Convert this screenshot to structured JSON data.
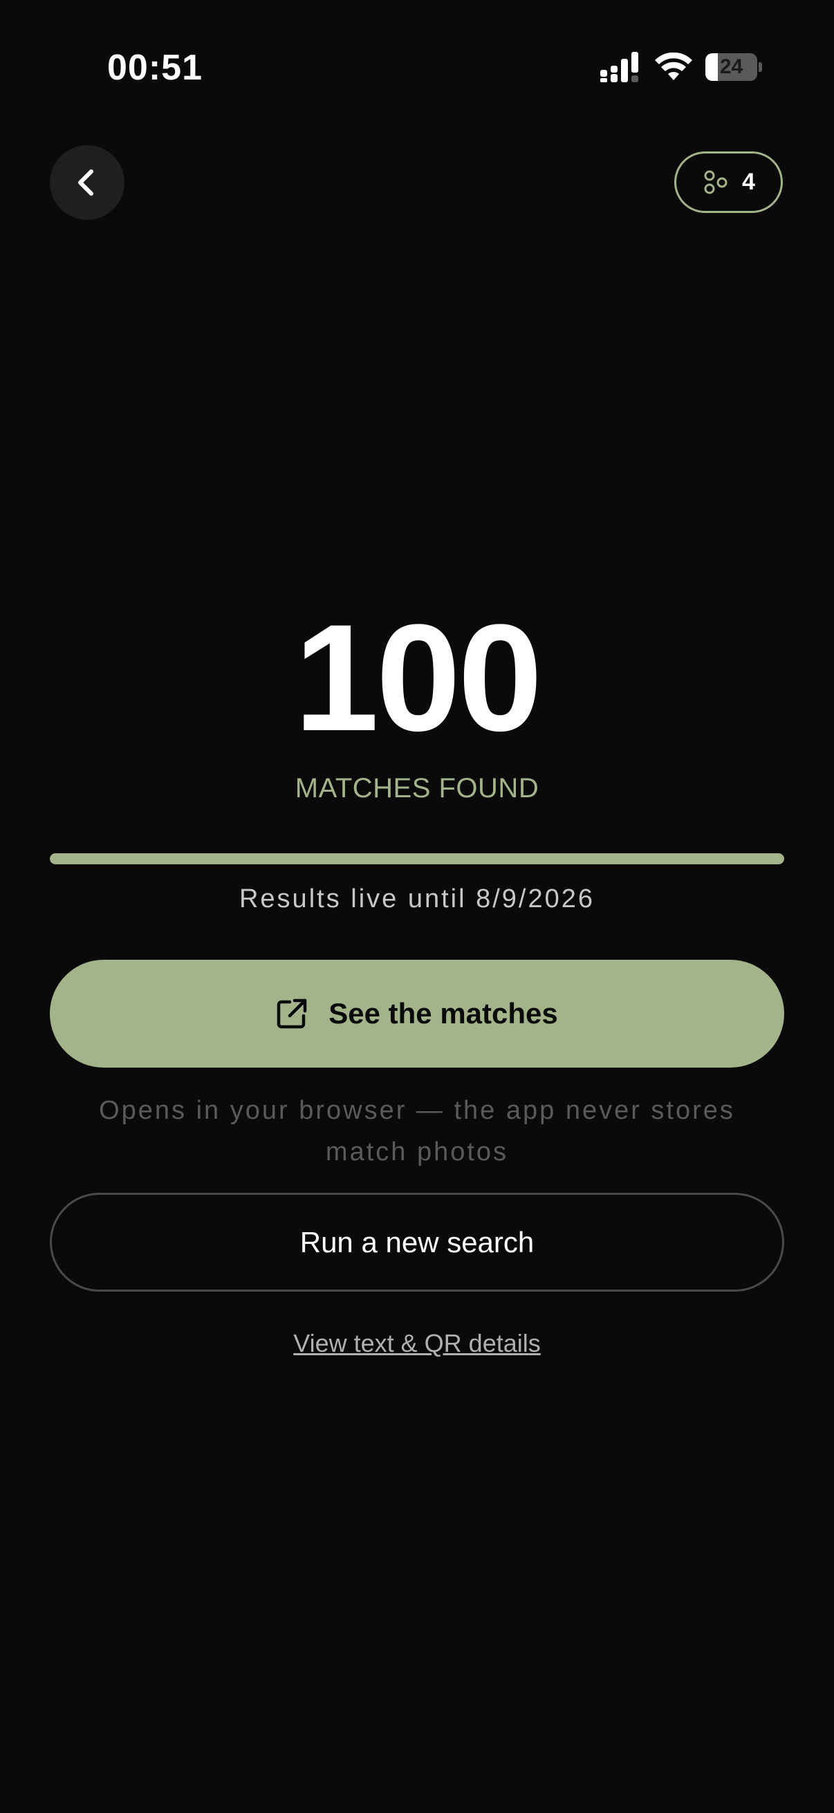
{
  "status_bar": {
    "time": "00:51",
    "battery_level": "24",
    "battery_fraction": 0.24
  },
  "header": {
    "back_icon": "chevron-left-icon",
    "count_icon": "people-group-icon",
    "count_value": "4"
  },
  "result": {
    "count": "100",
    "label": "MATCHES FOUND",
    "progress_fraction": 1.0,
    "live_until": "Results live until 8/9/2026"
  },
  "actions": {
    "primary_icon": "external-link-icon",
    "primary_label": "See the matches",
    "browser_note": "Opens in your browser — the app never stores match photos",
    "secondary_label": "Run a new search",
    "details_link": "View text & QR details"
  },
  "colors": {
    "background": "#0a0a0a",
    "accent": "#a3b38a",
    "surface": "#1f1f1f",
    "muted_text": "#5a5a5a"
  }
}
